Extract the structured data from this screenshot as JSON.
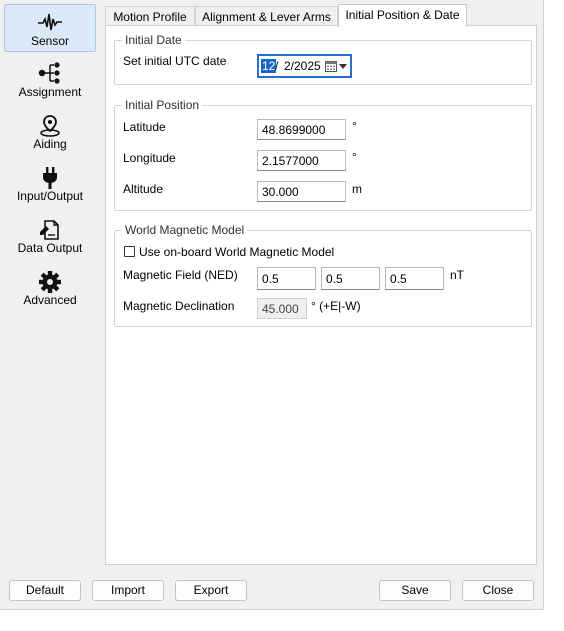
{
  "sidebar": {
    "items": [
      {
        "label": "Sensor",
        "icon": "waveform-icon"
      },
      {
        "label": "Assignment",
        "icon": "tree-icon"
      },
      {
        "label": "Aiding",
        "icon": "map-pin-icon"
      },
      {
        "label": "Input/Output",
        "icon": "plug-icon"
      },
      {
        "label": "Data Output",
        "icon": "document-edit-icon"
      },
      {
        "label": "Advanced",
        "icon": "gear-icon"
      }
    ],
    "active": "Sensor"
  },
  "tabs": [
    {
      "label": "Motion Profile"
    },
    {
      "label": "Alignment & Lever Arms"
    },
    {
      "label": "Initial Position & Date"
    }
  ],
  "active_tab": "Initial Position & Date",
  "initial_date": {
    "group_title": "Initial Date",
    "label": "Set initial UTC date",
    "day": "12",
    "separator": "/",
    "rest": "2/2025"
  },
  "initial_position": {
    "group_title": "Initial Position",
    "latitude_label": "Latitude",
    "latitude_value": "48.8699000",
    "latitude_unit": "°",
    "longitude_label": "Longitude",
    "longitude_value": "2.1577000",
    "longitude_unit": "°",
    "altitude_label": "Altitude",
    "altitude_value": "30.000",
    "altitude_unit": "m"
  },
  "magnetic_model": {
    "group_title": "World Magnetic Model",
    "checkbox_label": "Use on-board World Magnetic Model",
    "checked": false,
    "field_label": "Magnetic Field (NED)",
    "field_values": [
      "0.5",
      "0.5",
      "0.5"
    ],
    "field_unit": "nT",
    "declination_label": "Magnetic Declination",
    "declination_value": "45.000",
    "declination_unit": "° (+E|-W)"
  },
  "buttons": {
    "default": "Default",
    "import": "Import",
    "export": "Export",
    "save": "Save",
    "close": "Close"
  },
  "colors": {
    "accent": "#2a6fd1",
    "selection": "#1b66c9",
    "active_nav": "#dce9f8"
  }
}
